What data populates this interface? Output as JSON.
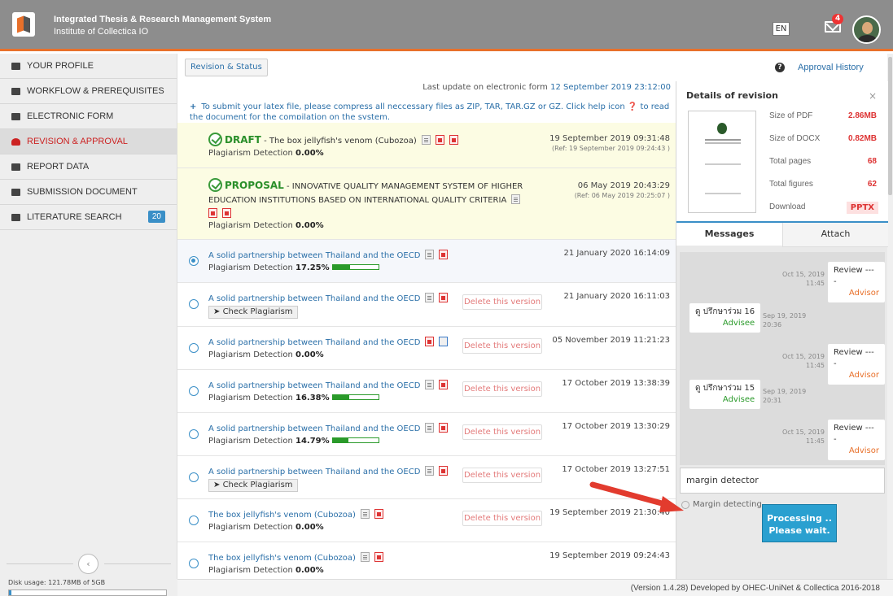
{
  "header": {
    "title": "Integrated Thesis & Research Management System",
    "subtitle": "Institute of Collectica IO",
    "lang": "EN",
    "mail_count": "4"
  },
  "sidebar": {
    "items": [
      {
        "label": "YOUR PROFILE"
      },
      {
        "label": "WORKFLOW & PREREQUISITES"
      },
      {
        "label": "ELECTRONIC FORM"
      },
      {
        "label": "REVISION & APPROVAL"
      },
      {
        "label": "REPORT DATA"
      },
      {
        "label": "SUBMISSION DOCUMENT"
      },
      {
        "label": "LITERATURE SEARCH",
        "count": "20"
      }
    ],
    "disk": "Disk usage: 121.78MB of 5GB",
    "collapse_icon": "‹"
  },
  "main": {
    "tab": "Revision & Status",
    "approval_history": "Approval History",
    "last_update_label": "Last update on electronic form",
    "last_update_value": "12 September 2019 23:12:00",
    "help": "To submit your latex file, please compress all neccessary files as ZIP, TAR, TAR.GZ or GZ. Click help icon ❓ to read the document for the compilation on the system.",
    "draft": {
      "tag": "DRAFT",
      "title": "- The box jellyfish's venom (Cubozoa)",
      "plag_label": "Plagiarism Detection",
      "plag": "0.00%",
      "date": "19 September 2019 09:31:48",
      "ref": "(Ref: 19 September 2019 09:24:43 )"
    },
    "proposal": {
      "tag": "PROPOSAL",
      "title": "- INNOVATIVE QUALITY MANAGEMENT SYSTEM OF HIGHER EDUCATION INSTITUTIONS BASED ON INTERNATIONAL QUALITY CRITERIA",
      "plag_label": "Plagiarism Detection",
      "plag": "0.00%",
      "date": "06 May 2019 20:43:29",
      "ref": "(Ref: 06 May 2019 20:25:07 )"
    },
    "delete_label": "Delete this version",
    "check_label": "Check Plagiarism",
    "plag_label": "Plagiarism Detection",
    "versions": [
      {
        "title": "A solid partnership between Thailand and the OECD",
        "plag": "17.25%",
        "level": 0.17,
        "date": "21 January 2020 16:14:09"
      },
      {
        "title": "A solid partnership between Thailand and the OECD",
        "date": "21 January 2020 16:11:03"
      },
      {
        "title": "A solid partnership between Thailand and the OECD",
        "plag": "0.00%",
        "date": "05 November 2019 11:21:23"
      },
      {
        "title": "A solid partnership between Thailand and the OECD",
        "plag": "16.38%",
        "level": 0.16,
        "date": "17 October 2019 13:38:39"
      },
      {
        "title": "A solid partnership between Thailand and the OECD",
        "plag": "14.79%",
        "level": 0.15,
        "date": "17 October 2019 13:30:29"
      },
      {
        "title": "A solid partnership between Thailand and the OECD",
        "date": "17 October 2019 13:27:51"
      },
      {
        "title": "The box jellyfish's venom (Cubozoa)",
        "plag": "0.00%",
        "date": "19 September 2019 21:30:40"
      },
      {
        "title": "The box jellyfish's venom (Cubozoa)",
        "plag": "0.00%",
        "date": "19 September 2019 09:24:43"
      }
    ]
  },
  "panel": {
    "title": "Details of revision",
    "close": "×",
    "details": [
      {
        "label": "Size of PDF",
        "value": "2.86MB"
      },
      {
        "label": "Size of DOCX",
        "value": "0.82MB"
      },
      {
        "label": "Total pages",
        "value": "68"
      },
      {
        "label": "Total figures",
        "value": "62"
      },
      {
        "label": "Download",
        "value": "PPTX"
      }
    ],
    "tabs": [
      "Messages",
      "Attach"
    ],
    "messages": [
      {
        "text": "Review --- -",
        "who": "Advisor",
        "time": "Oct 15, 2019",
        "time2": "11:45"
      },
      {
        "text": "ดู ปรึกษาร่วม 16",
        "who": "Advisee",
        "time": "Sep 19, 2019",
        "time2": "20:36"
      },
      {
        "text": "Review --- -",
        "who": "Advisor",
        "time": "Oct 15, 2019",
        "time2": "11:45"
      },
      {
        "text": "ดู ปรึกษาร่วม 15",
        "who": "Advisee",
        "time": "Sep 19, 2019",
        "time2": "20:31"
      },
      {
        "text": "Review --- -",
        "who": "Advisor",
        "time": "Oct 15, 2019",
        "time2": "11:45"
      }
    ],
    "input": "margin detector",
    "detecting": "Margin detecting",
    "processing1": "Processing ..",
    "processing2": "Please wait."
  },
  "footer": "(Version 1.4.28) Developed by OHEC-UniNet & Collectica 2016-2018"
}
